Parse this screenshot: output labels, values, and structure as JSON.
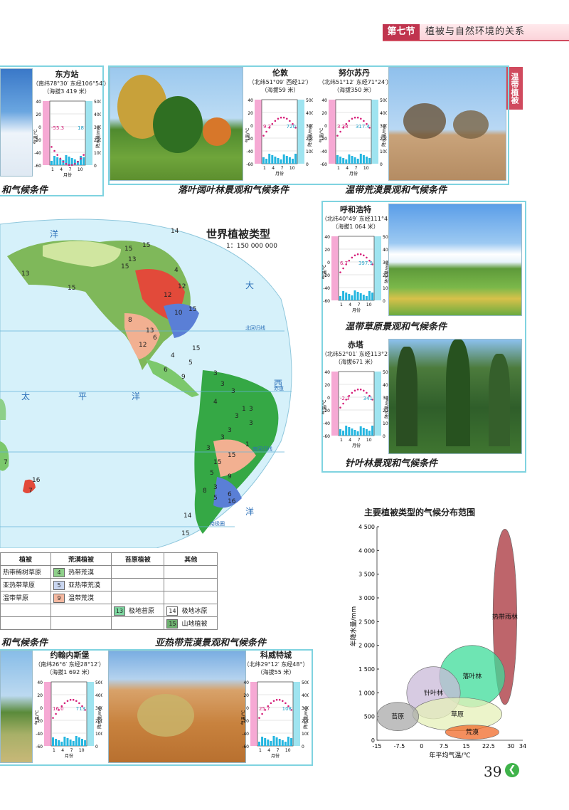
{
  "header": {
    "section": "第七节",
    "title": "植被与自然环境的关系"
  },
  "side_tab": "温带植被",
  "captions": {
    "polar": "和气候条件",
    "deciduous": "落叶阔叶林景观和气候条件",
    "temperate_desert": "温带荒漠景观和气候条件",
    "temperate_grassland": "温带草原景观和气候条件",
    "coniferous": "针叶林景观和气候条件",
    "bottom_left": "和气候条件",
    "subtropical_desert": "亚热带荒漠景观和气候条件"
  },
  "stations": [
    {
      "name": "东方站",
      "coord": "（南纬78°30′ 东经106°54′）",
      "alt": "（海拔3 419 米）",
      "temp_label": "-55.3",
      "rain_label": "18"
    },
    {
      "name": "伦敦",
      "coord": "（北纬51°09′ 西经12′）",
      "alt": "（海拔59 米）",
      "temp_label": "9.3",
      "rain_label": "720"
    },
    {
      "name": "努尔苏丹",
      "coord": "（北纬51°12′ 东经71°24′）",
      "alt": "（海拔350 米）",
      "temp_label": "3.38",
      "rain_label": "317.4"
    },
    {
      "name": "呼和浩特",
      "coord": "（北纬40°49′ 东经111°41′）",
      "alt": "（海拔1 064 米）",
      "temp_label": "6.7",
      "rain_label": "397.9"
    },
    {
      "name": "赤塔",
      "coord": "（北纬52°01′ 东经113°28′）",
      "alt": "（海拔671 米）",
      "temp_label": "-2.3",
      "rain_label": "341"
    },
    {
      "name": "约翰内斯堡",
      "coord": "（南纬26°6′ 东经28°12′）",
      "alt": "（海拔1 692 米）",
      "temp_label": "16.0",
      "rain_label": "713"
    },
    {
      "name": "科威特城",
      "coord": "（北纬29°12′ 东经48°）",
      "alt": "（海拔55 米）",
      "temp_label": "25.7",
      "rain_label": "108"
    }
  ],
  "climograph": {
    "temp_axis": "气温/℃",
    "rain_axis": "降水量/mm",
    "month_label": "月份",
    "months": [
      "1",
      "4",
      "7",
      "10"
    ],
    "temp_ticks": [
      "40",
      "20",
      "0",
      "-20",
      "-40",
      "-60"
    ],
    "rain_ticks": [
      "500",
      "400",
      "300",
      "200",
      "100",
      "0"
    ]
  },
  "map": {
    "title": "世界植被类型",
    "scale": "1：150 000 000",
    "labels": {
      "ocean1": "洋",
      "ocean2": "大",
      "ocean3": "太",
      "ocean4": "平",
      "ocean5": "洋",
      "ocean6": "西",
      "ocean7": "洋",
      "tropic_n": "北回归线",
      "equator": "赤道",
      "tropic_s": "南回归线",
      "polar_s": "南极圈"
    },
    "numbers": [
      "14",
      "15",
      "13",
      "15",
      "4",
      "15",
      "12",
      "13",
      "15",
      "12",
      "15",
      "8",
      "10",
      "13",
      "6",
      "12",
      "15",
      "4",
      "5",
      "6",
      "9",
      "3",
      "3",
      "3",
      "3",
      "4",
      "1",
      "3",
      "3",
      "3",
      "1",
      "3",
      "7",
      "15",
      "3",
      "15",
      "5",
      "9",
      "3",
      "6",
      "8",
      "5",
      "16",
      "14",
      "15",
      "7",
      "16"
    ]
  },
  "legend": {
    "headers": [
      "植被",
      "荒漠植被",
      "苔原植被",
      "其他"
    ],
    "rows": [
      [
        "热带稀树草原",
        "4",
        "热带荒漠",
        "",
        "",
        "",
        ""
      ],
      [
        "亚热带草原",
        "5",
        "亚热带荒漠",
        "",
        "",
        "",
        ""
      ],
      [
        "温带草原",
        "9",
        "温带荒漠",
        "",
        "",
        "",
        ""
      ],
      [
        "",
        "",
        "",
        "13",
        "极地苔原",
        "14",
        "极地冰原"
      ],
      [
        "",
        "",
        "",
        "",
        "",
        "15",
        "山地植被"
      ]
    ]
  },
  "colors": {
    "sw4": "#8ed08a",
    "sw5": "#c9d6f0",
    "sw9": "#f4b8a0",
    "sw13": "#7dd6a0",
    "sw14": "#ffffff",
    "sw15": "#6eb070"
  },
  "chart_data": {
    "type": "area",
    "title": "主要植被类型的气候分布范围",
    "xlabel": "年平均气温/℃",
    "ylabel": "年降水量/mm",
    "xticks": [
      "-15",
      "-7.5",
      "0",
      "7.5",
      "15",
      "22.5",
      "30",
      "34"
    ],
    "yticks": [
      "4 500",
      "4 000",
      "3 500",
      "3 000",
      "2 500",
      "2 000",
      "1 500",
      "1 000",
      "500",
      "0"
    ],
    "xlim": [
      -15,
      34
    ],
    "ylim": [
      0,
      4500
    ],
    "regions": [
      {
        "name": "热带雨林",
        "color": "#a8323a",
        "cx": 28,
        "cy": 2600,
        "w": 8,
        "h": 3700
      },
      {
        "name": "落叶林",
        "color": "#3ddc9a",
        "cx": 17,
        "cy": 1350,
        "w": 22,
        "h": 1300
      },
      {
        "name": "针叶林",
        "color": "#c9b9d8",
        "cx": 4,
        "cy": 1000,
        "w": 18,
        "h": 1100
      },
      {
        "name": "草原",
        "color": "#e6f0b8",
        "cx": 12,
        "cy": 550,
        "w": 30,
        "h": 700
      },
      {
        "name": "苔原",
        "color": "#a9a9a9",
        "cx": -8,
        "cy": 500,
        "w": 14,
        "h": 600
      },
      {
        "name": "荒漠",
        "color": "#f06a28",
        "cx": 17,
        "cy": 170,
        "w": 18,
        "h": 300
      }
    ]
  },
  "page_number": "39"
}
